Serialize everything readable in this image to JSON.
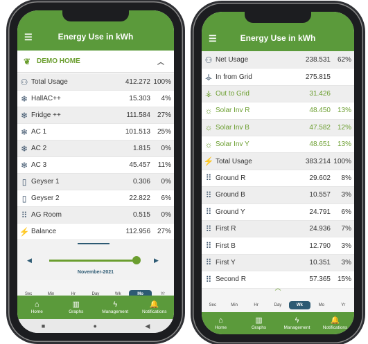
{
  "left": {
    "title": "Energy Use in kWh",
    "home_name": "DEMO HOME",
    "rows": [
      {
        "icon": "network-icon",
        "label": "Total Usage",
        "value": "412.272",
        "pct": "100%"
      },
      {
        "icon": "snowflake-icon",
        "label": "HallAC++",
        "value": "15.303",
        "pct": "4%"
      },
      {
        "icon": "snowflake-icon",
        "label": "Fridge ++",
        "value": "111.584",
        "pct": "27%"
      },
      {
        "icon": "snowflake-icon",
        "label": "AC 1",
        "value": "101.513",
        "pct": "25%"
      },
      {
        "icon": "snowflake-icon",
        "label": "AC 2",
        "value": "1.815",
        "pct": "0%"
      },
      {
        "icon": "snowflake-icon",
        "label": "AC 3",
        "value": "45.457",
        "pct": "11%"
      },
      {
        "icon": "geyser-icon",
        "label": "Geyser 1",
        "value": "0.306",
        "pct": "0%"
      },
      {
        "icon": "geyser-icon",
        "label": "Geyser 2",
        "value": "22.822",
        "pct": "6%"
      },
      {
        "icon": "grid-dots-icon",
        "label": "AG Room",
        "value": "0.515",
        "pct": "0%"
      },
      {
        "icon": "lightning-icon",
        "label": "Balance",
        "value": "112.956",
        "pct": "27%"
      }
    ],
    "date_label": "November-2021",
    "periods": [
      "Sec",
      "Min",
      "Hr",
      "Day",
      "Wk",
      "Mo",
      "Yr"
    ],
    "selected_period": "Mo",
    "tabs": [
      "Home",
      "Graphs",
      "Management",
      "Notifications"
    ]
  },
  "right": {
    "title": "Energy Use in kWh",
    "rows": [
      {
        "icon": "network-icon",
        "label": "Net Usage",
        "value": "238.531",
        "pct": "62%",
        "style": "gray"
      },
      {
        "icon": "tower-icon",
        "label": "In from Grid",
        "value": "275.815",
        "pct": "",
        "style": "alt"
      },
      {
        "icon": "tower-icon",
        "label": "Out to Grid",
        "value": "31.426",
        "pct": "",
        "style": "gray",
        "green": true
      },
      {
        "icon": "sun-icon",
        "label": "Solar Inv R",
        "value": "48.450",
        "pct": "13%",
        "style": "alt",
        "green": true
      },
      {
        "icon": "sun-icon",
        "label": "Solar Inv B",
        "value": "47.582",
        "pct": "12%",
        "style": "gray",
        "green": true
      },
      {
        "icon": "sun-icon",
        "label": "Solar Inv Y",
        "value": "48.651",
        "pct": "13%",
        "style": "alt",
        "green": true
      },
      {
        "icon": "lightning-icon",
        "label": "Total Usage",
        "value": "383.214",
        "pct": "100%",
        "style": "gray"
      },
      {
        "icon": "grid-dots-icon",
        "label": "Ground R",
        "value": "29.602",
        "pct": "8%",
        "style": "alt"
      },
      {
        "icon": "grid-dots-icon",
        "label": "Ground B",
        "value": "10.557",
        "pct": "3%",
        "style": "gray"
      },
      {
        "icon": "grid-dots-icon",
        "label": "Ground Y",
        "value": "24.791",
        "pct": "6%",
        "style": "alt"
      },
      {
        "icon": "grid-dots-icon",
        "label": "First R",
        "value": "24.936",
        "pct": "7%",
        "style": "gray"
      },
      {
        "icon": "grid-dots-icon",
        "label": "First B",
        "value": "12.790",
        "pct": "3%",
        "style": "alt"
      },
      {
        "icon": "grid-dots-icon",
        "label": "First Y",
        "value": "10.351",
        "pct": "3%",
        "style": "gray"
      },
      {
        "icon": "grid-dots-icon",
        "label": "Second R",
        "value": "57.365",
        "pct": "15%",
        "style": "alt"
      }
    ],
    "periods": [
      "Sec",
      "Min",
      "Hr",
      "Day",
      "Wk",
      "Mo",
      "Yr"
    ],
    "selected_period": "Wk",
    "tabs": [
      "Home",
      "Graphs",
      "Management",
      "Notifications"
    ]
  }
}
